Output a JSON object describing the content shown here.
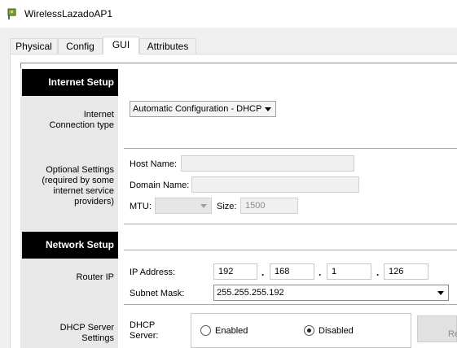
{
  "window": {
    "title": "WirelessLazadoAP1"
  },
  "tabs": [
    {
      "label": "Physical"
    },
    {
      "label": "Config"
    },
    {
      "label": "GUI"
    },
    {
      "label": "Attributes"
    }
  ],
  "active_tab": "GUI",
  "internet_setup": {
    "header": "Internet Setup",
    "connection_type_label_line1": "Internet",
    "connection_type_label_line2": "Connection type",
    "connection_type_value": "Automatic Configuration - DHCP",
    "optional_label_line1": "Optional Settings",
    "optional_label_line2": "(required by some",
    "optional_label_line3": "internet service",
    "optional_label_line4": "providers)",
    "host_name_label": "Host Name:",
    "host_name_value": "",
    "domain_name_label": "Domain Name:",
    "domain_name_value": "",
    "mtu_label": "MTU:",
    "mtu_value": "",
    "size_label": "Size:",
    "size_value": "1500"
  },
  "network_setup": {
    "header": "Network Setup",
    "router_ip_label": "Router IP",
    "ip_address_label": "IP Address:",
    "ip_octets": [
      "192",
      "168",
      "1",
      "126"
    ],
    "dot": ".",
    "subnet_mask_label": "Subnet Mask:",
    "subnet_mask_value": "255.255.255.192",
    "dhcp_settings_label_line1": "DHCP Server",
    "dhcp_settings_label_line2": "Settings",
    "dhcp_server_label_line1": "DHCP",
    "dhcp_server_label_line2": "Server:",
    "enabled_label": "Enabled",
    "disabled_label": "Disabled",
    "dhcp_selected": "Disabled",
    "side_button_partial": "Re"
  }
}
